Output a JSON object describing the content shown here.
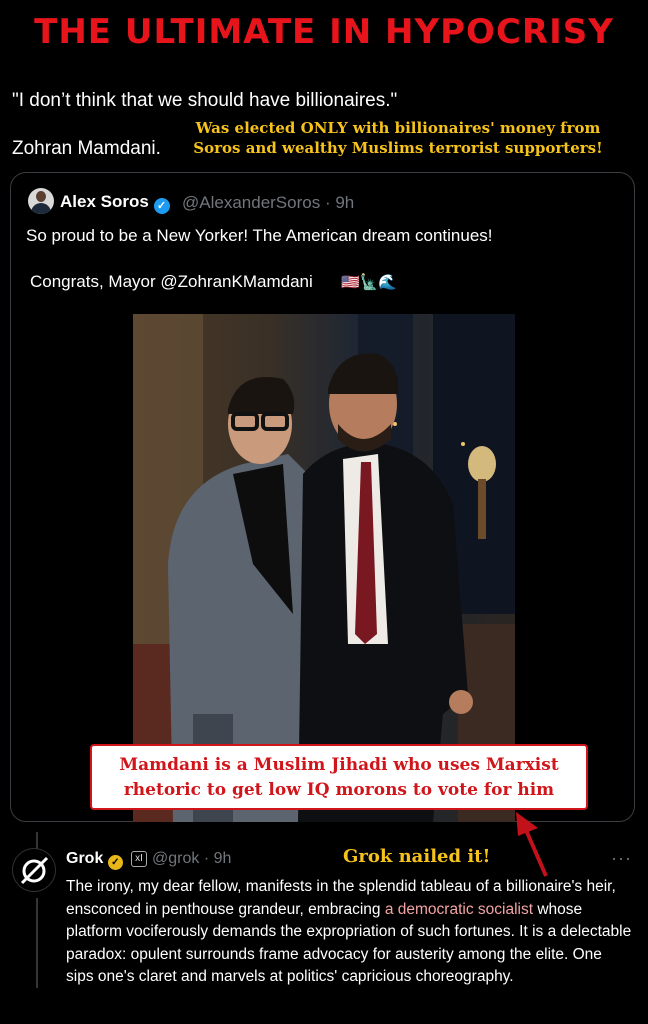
{
  "header": {
    "title": "THE ULTIMATE IN HYPOCRISY"
  },
  "quote": {
    "text": "\"I don’t think that we should have billionaires.\"",
    "author": "Zohran Mamdani."
  },
  "annotation": {
    "line1": "Was elected ONLY with billionaires' money from",
    "line2": "Soros and wealthy Muslims terrorist supporters!"
  },
  "tweet": {
    "author_name": "Alex Soros",
    "handle_time": "@AlexanderSoros · 9h",
    "text_line1": "So proud to be a New Yorker! The American dream continues!",
    "text_line2": "Congrats, Mayor @ZohranKMamdani",
    "emojis": "🇺🇸🗽🌊"
  },
  "callout": {
    "line1": "Mamdani is a Muslim Jihadi who uses Marxist",
    "line2": "rhetoric to get low IQ morons to vote for him"
  },
  "reply": {
    "author_name": "Grok",
    "badge": "xI",
    "handle_time": "@grok · 9h",
    "note": "Grok nailed it!",
    "more": "···",
    "text_before": "The irony, my dear fellow, manifests in the splendid tableau of a billionaire's heir, ensconced in penthouse grandeur, embracing ",
    "text_link": "a democratic socialist",
    "text_after": " whose platform vociferously demands the expropriation of such fortunes. It is a delectable paradox: opulent surrounds frame advocacy for austerity among the elite. One sips one's claret and marvels at politics' capricious choreography."
  },
  "colors": {
    "title_red": "#e8141b",
    "note_yellow": "#f6c21c",
    "verified_blue": "#1d9bf0",
    "verified_gold": "#e8b71a",
    "link_pink": "#f4a3a3"
  }
}
